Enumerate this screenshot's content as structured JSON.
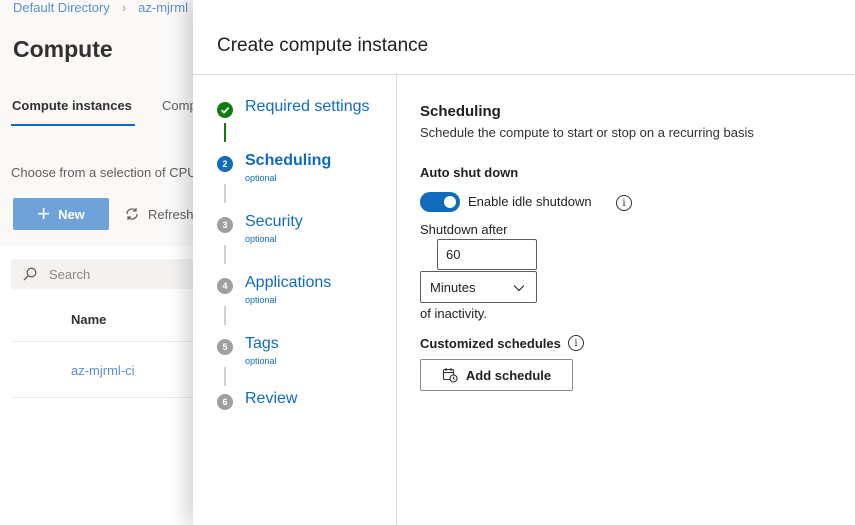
{
  "breadcrumb": {
    "item1": "Default Directory",
    "item2": "az-mjrml"
  },
  "background": {
    "title": "Compute",
    "tabs": [
      "Compute instances",
      "Compute clusters"
    ],
    "description": "Choose from a selection of CPU or GPU instances",
    "new_label": "New",
    "refresh_label": "Refresh",
    "search_placeholder": "Search",
    "name_header": "Name",
    "row_name": "az-mjrml-ci"
  },
  "panel": {
    "title": "Create compute instance",
    "steps": [
      {
        "num": "1",
        "label": "Required settings",
        "sub": "",
        "state": "done"
      },
      {
        "num": "2",
        "label": "Scheduling",
        "sub": "optional",
        "state": "current"
      },
      {
        "num": "3",
        "label": "Security",
        "sub": "optional",
        "state": "todo"
      },
      {
        "num": "4",
        "label": "Applications",
        "sub": "optional",
        "state": "todo"
      },
      {
        "num": "5",
        "label": "Tags",
        "sub": "optional",
        "state": "todo"
      },
      {
        "num": "6",
        "label": "Review",
        "sub": "",
        "state": "todo"
      }
    ],
    "content": {
      "heading": "Scheduling",
      "description": "Schedule the compute to start or stop on a recurring basis",
      "auto_shutdown_label": "Auto shut down",
      "enable_idle_label": "Enable idle shutdown",
      "enable_idle_on": true,
      "shutdown_after_label": "Shutdown after",
      "shutdown_value": "60",
      "unit_value": "Minutes",
      "inactivity_label": "of inactivity.",
      "custom_schedules_label": "Customized schedules",
      "add_schedule_label": "Add schedule"
    }
  },
  "colors": {
    "accent": "#0f6cbd",
    "done": "#107c10",
    "pending": "#a19f9d"
  }
}
